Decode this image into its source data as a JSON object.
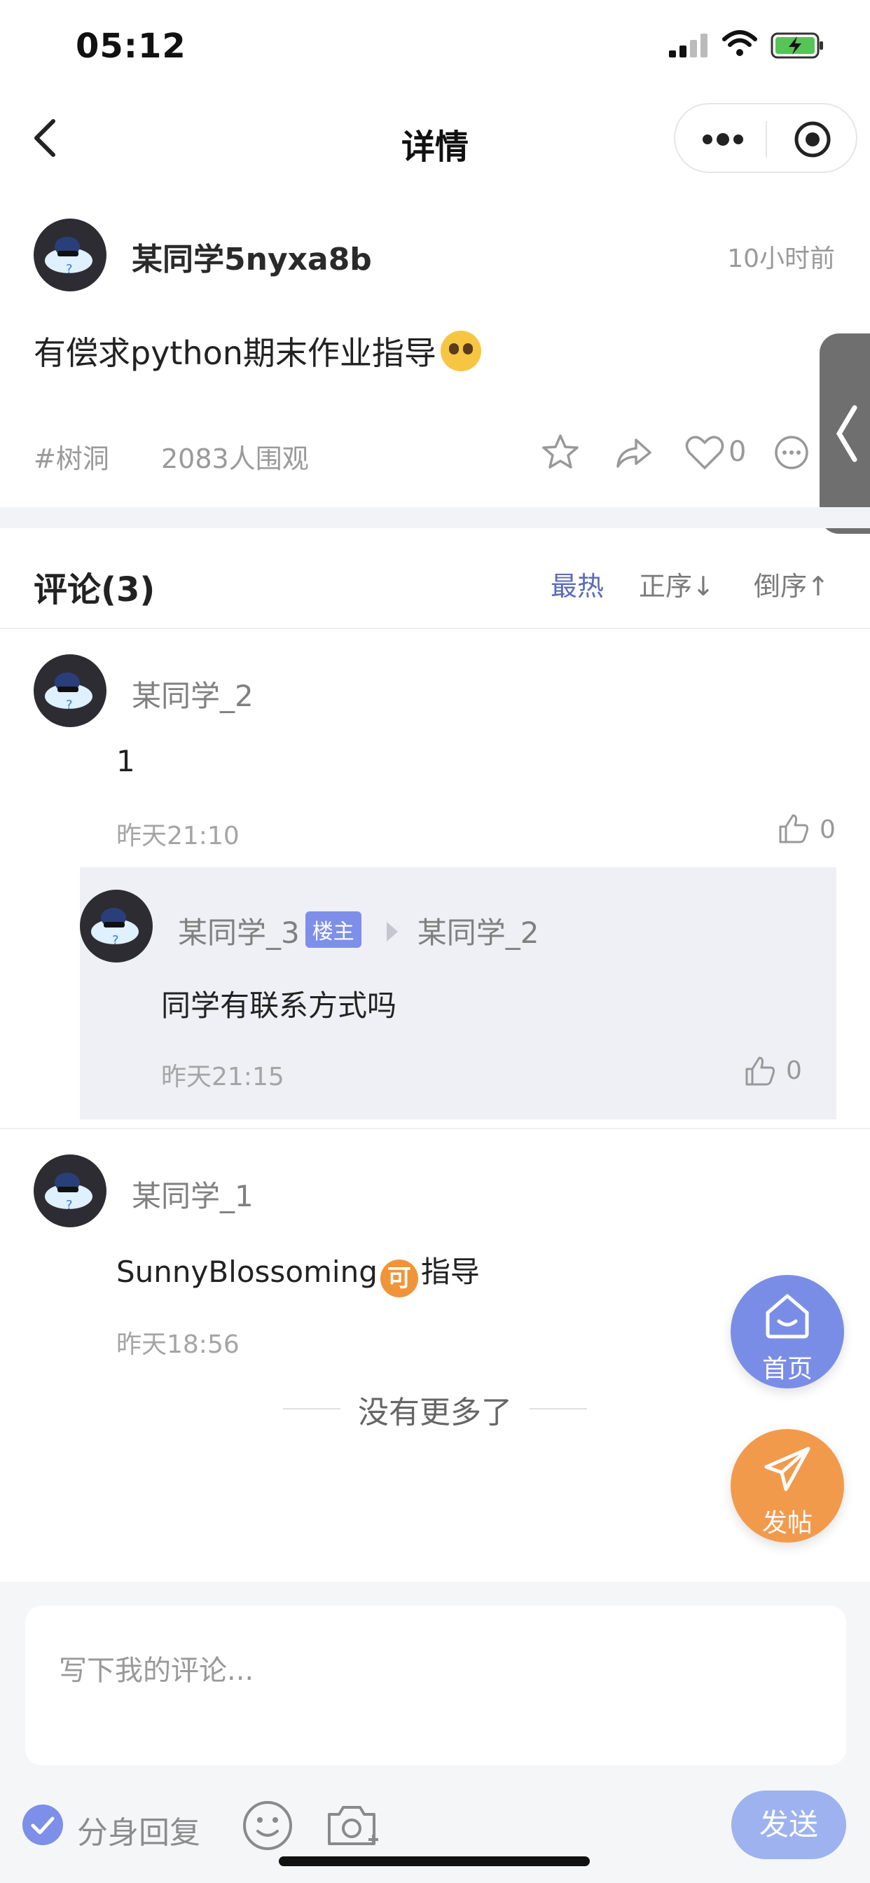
{
  "status": {
    "time": "05:12"
  },
  "nav": {
    "title": "详情"
  },
  "post": {
    "author": "某同学5nyxa8b",
    "time": "10小时前",
    "content": "有偿求python期末作业指导",
    "tag": "#树洞",
    "views": "2083人围观",
    "likes": "0"
  },
  "comments_header": {
    "title": "评论(3)",
    "sort_hot": "最热",
    "sort_asc": "正序↓",
    "sort_desc": "倒序↑"
  },
  "comments": [
    {
      "author": "某同学_2",
      "text": "1",
      "time": "昨天21:10",
      "likes": "0",
      "reply": {
        "author": "某同学_3",
        "badge": "楼主",
        "reply_to": "某同学_2",
        "text": "同学有联系方式吗",
        "time": "昨天21:15",
        "likes": "0"
      }
    },
    {
      "author": "某同学_1",
      "text_before": "SunnyBlossoming",
      "emoji_text": "可",
      "text_after": "指导",
      "time": "昨天18:56"
    }
  ],
  "no_more": "没有更多了",
  "fab": {
    "home": "首页",
    "post": "发帖"
  },
  "composer": {
    "placeholder": "写下我的评论...",
    "alias_label": "分身回复",
    "send_label": "发送"
  },
  "colors": {
    "accent": "#7d8fe8",
    "sort_active": "#5b6bb8",
    "fab_post": "#f29a4c"
  }
}
